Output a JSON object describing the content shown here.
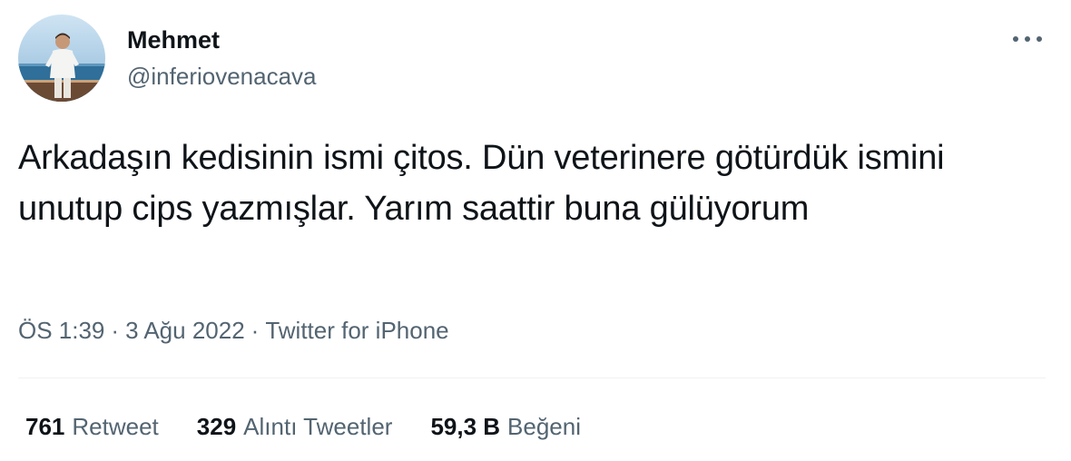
{
  "author": {
    "name": "Mehmet",
    "handle": "@inferiovenacava",
    "avatar_icon": "profile-photo"
  },
  "tweet": {
    "text": "Arkadaşın kedisinin ismi çitos. Dün veterinere götürdük ismini unutup cips yazmışlar. Yarım saattir buna gülüyorum"
  },
  "meta": {
    "time": "ÖS 1:39",
    "separator": "·",
    "date": "3 Ağu 2022",
    "source": "Twitter for iPhone"
  },
  "stats": {
    "retweets": {
      "count": "761",
      "label": "Retweet"
    },
    "quotes": {
      "count": "329",
      "label": "Alıntı Tweetler"
    },
    "likes": {
      "count": "59,3 B",
      "label": "Beğeni"
    }
  },
  "colors": {
    "text_primary": "#0f1419",
    "text_secondary": "#536471",
    "divider": "#eff3f4"
  },
  "icons": {
    "more": "more-horizontal-icon"
  }
}
